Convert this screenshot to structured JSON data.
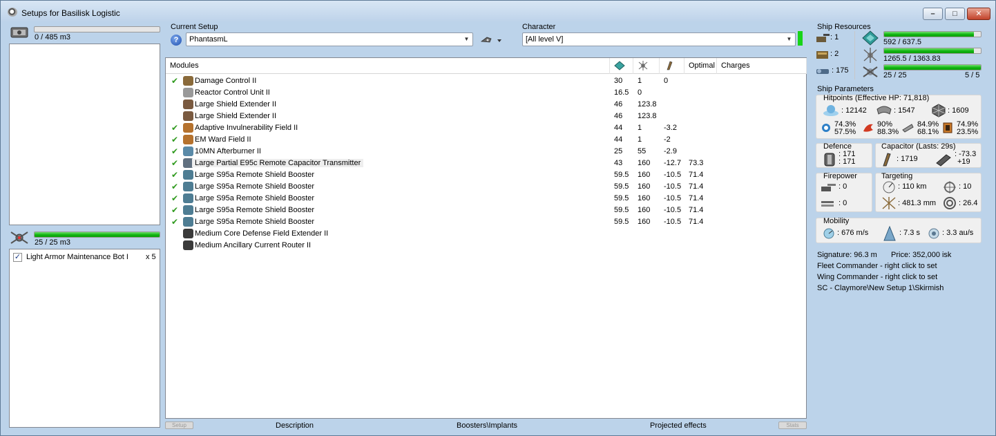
{
  "window": {
    "title": "Setups for Basilisk Logistic",
    "minimize_glyph": "–",
    "maximize_glyph": "□",
    "close_glyph": "✕"
  },
  "left": {
    "cargo": {
      "text": "0 / 485 m3",
      "fill": 0
    },
    "drones": {
      "text": "25 / 25 m3",
      "fill": 1.0
    },
    "drone_items": [
      {
        "name": "Light Armor Maintenance Bot I",
        "count": "x 5",
        "checked": true
      }
    ]
  },
  "setup": {
    "label": "Current Setup",
    "value": "PhantasmL",
    "help_glyph": "?",
    "character_label": "Character",
    "character_value": "[All level V]"
  },
  "modules": {
    "headers": {
      "name": "Modules",
      "optimal": "Optimal",
      "charges": "Charges"
    },
    "rows": [
      {
        "check": "✔",
        "name": "Damage Control II",
        "c1": "30",
        "c2": "1",
        "c3": "0",
        "c4": ""
      },
      {
        "check": "",
        "name": "Reactor Control Unit II",
        "c1": "16.5",
        "c2": "0",
        "c3": "",
        "c4": ""
      },
      {
        "check": "",
        "name": "Large Shield Extender II",
        "c1": "46",
        "c2": "123.8",
        "c3": "",
        "c4": ""
      },
      {
        "check": "",
        "name": "Large Shield Extender II",
        "c1": "46",
        "c2": "123.8",
        "c3": "",
        "c4": ""
      },
      {
        "check": "✔",
        "name": "Adaptive Invulnerability Field II",
        "c1": "44",
        "c2": "1",
        "c3": "-3.2",
        "c4": ""
      },
      {
        "check": "✔",
        "name": "EM Ward Field II",
        "c1": "44",
        "c2": "1",
        "c3": "-2",
        "c4": ""
      },
      {
        "check": "✔",
        "name": "10MN Afterburner II",
        "c1": "25",
        "c2": "55",
        "c3": "-2.9",
        "c4": ""
      },
      {
        "check": "✔",
        "name": "Large Partial E95c Remote Capacitor Transmitter",
        "c1": "43",
        "c2": "160",
        "c3": "-12.7",
        "c4": "73.3"
      },
      {
        "check": "✔",
        "name": "Large S95a Remote Shield Booster",
        "c1": "59.5",
        "c2": "160",
        "c3": "-10.5",
        "c4": "71.4"
      },
      {
        "check": "✔",
        "name": "Large S95a Remote Shield Booster",
        "c1": "59.5",
        "c2": "160",
        "c3": "-10.5",
        "c4": "71.4"
      },
      {
        "check": "✔",
        "name": "Large S95a Remote Shield Booster",
        "c1": "59.5",
        "c2": "160",
        "c3": "-10.5",
        "c4": "71.4"
      },
      {
        "check": "✔",
        "name": "Large S95a Remote Shield Booster",
        "c1": "59.5",
        "c2": "160",
        "c3": "-10.5",
        "c4": "71.4"
      },
      {
        "check": "✔",
        "name": "Large S95a Remote Shield Booster",
        "c1": "59.5",
        "c2": "160",
        "c3": "-10.5",
        "c4": "71.4"
      },
      {
        "check": "",
        "name": "Medium Core Defense Field Extender II",
        "c1": "",
        "c2": "",
        "c3": "",
        "c4": ""
      },
      {
        "check": "",
        "name": "Medium Ancillary Current Router II",
        "c1": "",
        "c2": "",
        "c3": "",
        "c4": ""
      }
    ]
  },
  "bottom_tabs": {
    "left_btn": "Setup",
    "description": "Description",
    "boosters": "Boosters\\Implants",
    "projected": "Projected effects",
    "right_btn": "Stats"
  },
  "resources": {
    "title": "Ship Resources",
    "turrets": ": 1",
    "launchers": ": 2",
    "calibration": ": 175",
    "cpu": {
      "text": "592 / 637.5",
      "fill": 0.929
    },
    "powergrid": {
      "text": "1265.5 / 1363.83",
      "fill": 0.928
    },
    "drone_bw": {
      "text": "25 / 25",
      "fill": 1.0
    },
    "drones_active": "5 / 5"
  },
  "params": {
    "title": "Ship Parameters",
    "hitpoints_label": "Hitpoints (Effective HP: 71,818)",
    "shield_hp": ": 12142",
    "armor_hp": ": 1547",
    "structure_hp": ": 1609",
    "resists": [
      {
        "a": "74.3%",
        "b": "57.5%"
      },
      {
        "a": "90%",
        "b": "88.3%"
      },
      {
        "a": "84.9%",
        "b": "68.1%"
      },
      {
        "a": "74.9%",
        "b": "23.5%"
      }
    ],
    "defence_label": "Defence",
    "defence": {
      "a": ": 171",
      "b": ": 171"
    },
    "capacitor_label": "Capacitor (Lasts: 29s)",
    "cap_amount": ": 1719",
    "cap_delta": {
      "a": ": -73.3",
      "b": "+19"
    },
    "firepower_label": "Firepower",
    "fp_turret": ": 0",
    "fp_missile": ": 0",
    "targeting_label": "Targeting",
    "target_range": ": 110 km",
    "max_targets": ": 10",
    "scan_res": ": 481.3 mm",
    "sensor": ": 26.4",
    "mobility_label": "Mobility",
    "velocity": ": 676 m/s",
    "align": ": 7.3 s",
    "warp": ": 3.3 au/s",
    "signature": "Signature: 96.3 m",
    "price": "Price: 352,000 isk",
    "fleet_cmd": "Fleet Commander - right click to set",
    "wing_cmd": "Wing Commander - right click to set",
    "sc": "SC - Claymore\\New Setup 1\\Skirmish"
  },
  "colors": {
    "bar_green": "#10b410",
    "check_green": "#2f9a1e",
    "frame_blue": "#bcd3ea"
  }
}
